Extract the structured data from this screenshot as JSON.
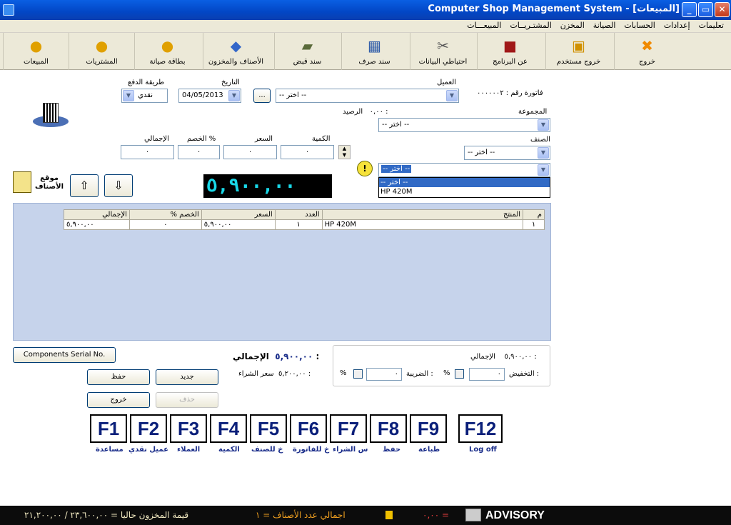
{
  "window": {
    "title": "Computer Shop Management System - [المبيعات]",
    "minimize": "_",
    "restore": "▭",
    "close": "✕"
  },
  "menu": [
    "المبيعـــات",
    "المشتـريــات",
    "المخزن",
    "الصيانة",
    "الحسابات",
    "إعدادات",
    "تعليمات"
  ],
  "toolbar": [
    {
      "label": "المبيعات",
      "icon": "user-icon"
    },
    {
      "label": "المشتريات",
      "icon": "user-document-icon"
    },
    {
      "label": "بطاقة صيانة",
      "icon": "user-card-icon"
    },
    {
      "label": "الأصناف والمخزون",
      "icon": "items-icon"
    },
    {
      "label": "سند قبض",
      "icon": "money-icon"
    },
    {
      "label": "سند صرف",
      "icon": "chart-icon"
    },
    {
      "label": "احتياطي البيانات",
      "icon": "tools-icon"
    },
    {
      "label": "عن البرنامج",
      "icon": "book-icon"
    },
    {
      "label": "خروج مستخدم",
      "icon": "lock-user-icon"
    },
    {
      "label": "خروج",
      "icon": "exit-icon"
    }
  ],
  "form": {
    "invoice_label": "فاتورة رقم :",
    "invoice_number": "٠٠٠٠٠٠٢",
    "customer_label": "العميل",
    "customer_value": "-- اختر --",
    "date_label": "التاريخ",
    "date_value": "04/05/2013",
    "browse_button": "...",
    "payment_label": "طريقة الدفع",
    "payment_value": "نقدي",
    "balance_label": "الرصيد :",
    "balance_value": "٠,٠٠",
    "group_label": "المجموعة",
    "group_value": "-- اختر --",
    "item_label": "الصنف",
    "item_value": "-- اختر --",
    "product_value": "-- اختر --",
    "qty_label": "الكمية",
    "qty_value": "٠",
    "price_label": "السعر",
    "price_value": "٠",
    "discount_label": "الخصم %",
    "discount_value": "٠",
    "total_label": "الإجمالي",
    "total_value": "٠",
    "location_label": "موقع الأصناف",
    "led_value": "٥,٩٠٠,٠٠"
  },
  "dropdown_options": [
    "-- اختر --",
    "HP 420M"
  ],
  "grid": {
    "headers": [
      "م",
      "المنتج",
      "العدد",
      "السعر",
      "الخصم %",
      "الإجمالي"
    ],
    "rows": [
      [
        "١",
        "HP 420M",
        "١",
        "٥,٩٠٠,٠٠",
        "٠",
        "٥,٩٠٠,٠٠"
      ]
    ]
  },
  "bottom": {
    "serial_button": "Components Serial No.",
    "total_label": "الإجمالي :",
    "total_value": "٥,٩٠٠,٠٠",
    "purchase_label": "سعر الشراء :",
    "purchase_value": "٥,٢٠٠,٠٠",
    "new_button": "جديد",
    "save_button": "حفظ",
    "delete_button": "حذف",
    "exit_button": "خروج",
    "summary_total_label": "الإجمالي :",
    "summary_total_value": "٥,٩٠٠,٠٠",
    "discount_label": "التخفيض :",
    "discount_value": "٠",
    "percent": "%",
    "tax_label": "الضريبة :",
    "tax_value": "٠"
  },
  "fkeys": [
    {
      "key": "F1",
      "label": "مساعدة"
    },
    {
      "key": "F2",
      "label": "عميل نقدي"
    },
    {
      "key": "F3",
      "label": "العملاء"
    },
    {
      "key": "F4",
      "label": "الكمية"
    },
    {
      "key": "F5",
      "label": "خ للصنف"
    },
    {
      "key": "F6",
      "label": "خ للفاتورة"
    },
    {
      "key": "F7",
      "label": "س الشراء"
    },
    {
      "key": "F8",
      "label": "حفظ"
    },
    {
      "key": "F9",
      "label": "طباعة"
    },
    {
      "key": "F12",
      "label": "Log off"
    }
  ],
  "status": {
    "stock_value": "قيمة المخزون حاليا = ٢٣,٦٠٠,٠٠ / ٢١,٢٠٠,٠٠",
    "items_count": "اجمالي عدد الأصناف = ١",
    "amount": "٠,٠٠ =",
    "brand": "ADVISORY"
  }
}
